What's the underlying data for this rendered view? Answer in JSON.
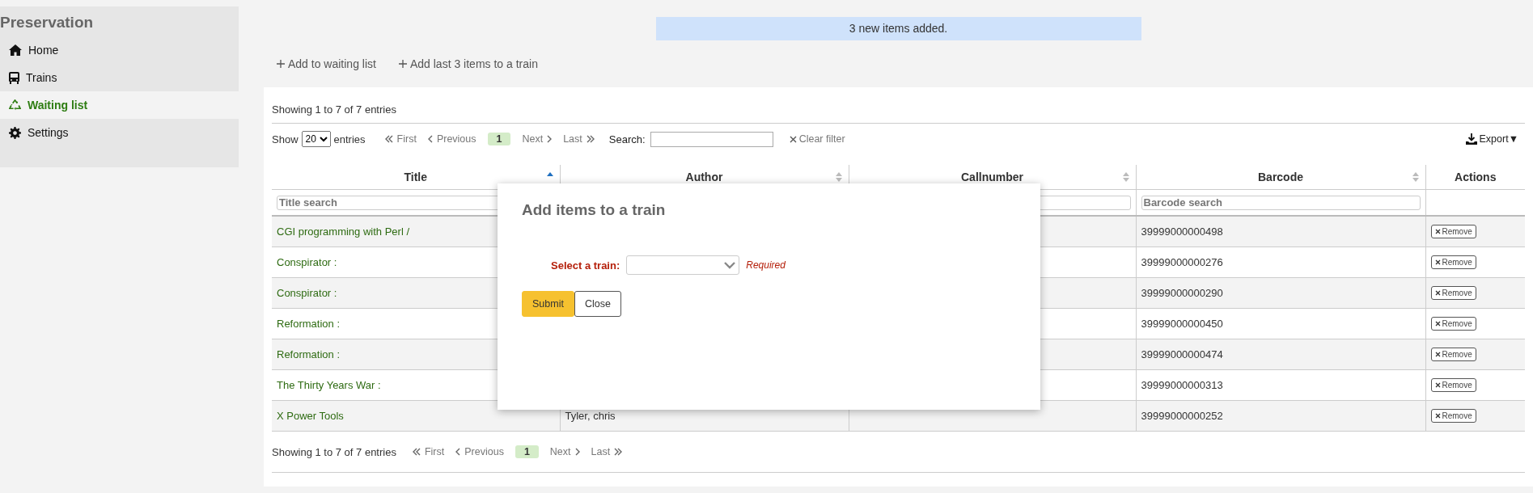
{
  "sidebar": {
    "title": "Preservation",
    "items": [
      {
        "label": "Home",
        "selected": false
      },
      {
        "label": "Trains",
        "selected": false
      },
      {
        "label": "Waiting list",
        "selected": true
      },
      {
        "label": "Settings",
        "selected": false
      }
    ]
  },
  "banner": "3 new items added.",
  "toolbar": [
    "Add to waiting list",
    "Add last 3 items to a train"
  ],
  "info_top": "Showing 1 to 7 of 7 entries",
  "length": {
    "show": "Show",
    "value": "20",
    "entries": "entries"
  },
  "pager_top": {
    "first": "First",
    "previous": "Previous",
    "page": "1",
    "next": "Next",
    "last": "Last"
  },
  "search": {
    "label": "Search:"
  },
  "clear_filter": "Clear filter",
  "export": {
    "label": "Export",
    "caret": "▼"
  },
  "columns": [
    {
      "label": "Title",
      "sorted": true,
      "filter": true,
      "filter_placeholder": "Title search"
    },
    {
      "label": "Author",
      "sorted": false
    },
    {
      "label": "Callnumber",
      "sorted": false,
      "filter": true
    },
    {
      "label": "Barcode",
      "sorted": false,
      "filter": true,
      "filter_placeholder": "Barcode search"
    },
    {
      "label": "Actions",
      "filter": false
    }
  ],
  "rows": [
    {
      "title": "CGI programming with Perl /",
      "barcode": "39999000000498",
      "action": "Remove"
    },
    {
      "title": "Conspirator :",
      "barcode": "39999000000276",
      "action": "Remove"
    },
    {
      "title": "Conspirator :",
      "barcode": "39999000000290",
      "action": "Remove"
    },
    {
      "title": "Reformation :",
      "barcode": "39999000000450",
      "action": "Remove"
    },
    {
      "title": "Reformation :",
      "barcode": "39999000000474",
      "action": "Remove"
    },
    {
      "title": "The Thirty Years War :",
      "barcode": "39999000000313",
      "action": "Remove"
    },
    {
      "title": "X Power Tools",
      "author": "Tyler, chris",
      "barcode": "39999000000252",
      "action": "Remove"
    }
  ],
  "info_bottom": "Showing 1 to 7 of 7 entries",
  "pager_bottom": {
    "first": "First",
    "previous": "Previous",
    "page": "1",
    "next": "Next",
    "last": "Last"
  },
  "modal": {
    "title": "Add items to a train",
    "field_label": "Select a train:",
    "required": "Required",
    "submit": "Submit",
    "close": "Close"
  }
}
